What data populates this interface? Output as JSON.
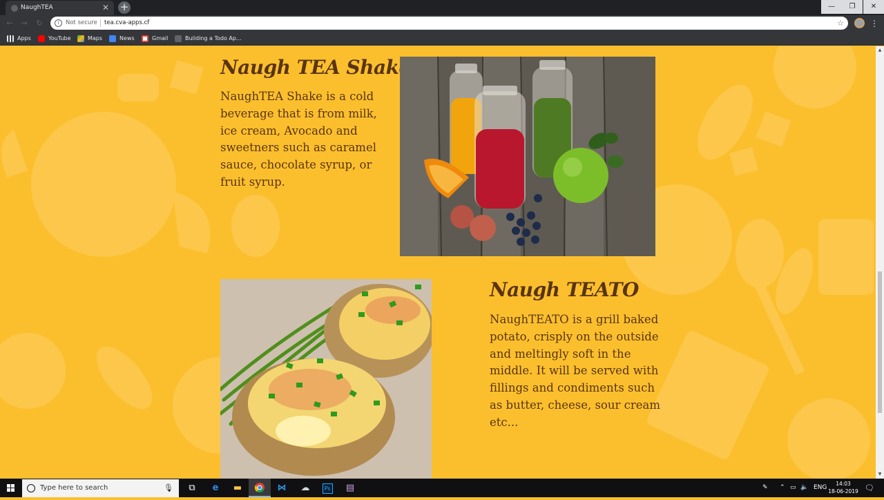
{
  "browser": {
    "tab_title": "NaughTEA",
    "tab_close": "✕",
    "new_tab": "+",
    "security_label": "Not secure",
    "url": "tea.cva-apps.cf",
    "window_min": "—",
    "window_max": "❐",
    "window_close": "✕"
  },
  "bookmarks": [
    {
      "label": "Apps",
      "color": "#e8eaed"
    },
    {
      "label": "YouTube",
      "color": "#ff0000"
    },
    {
      "label": "Maps",
      "color": "#34a853"
    },
    {
      "label": "News",
      "color": "#4285f4"
    },
    {
      "label": "Gmail",
      "color": "#ea4335"
    },
    {
      "label": "Building a Todo Ap...",
      "color": "#9aa0a6"
    }
  ],
  "content": {
    "shake": {
      "title": "Naugh TEA Shake",
      "description": "NaughTEA Shake is a cold beverage that is from milk, ice cream, Avocado and sweetners such as caramel sauce, chocolate syrup, or fruit syrup."
    },
    "teato": {
      "title": "Naugh TEATO",
      "description": "NaughTEATO is a grill baked potato, crisply on the outside and meltingly soft in the middle. It will be served with fillings and condiments such as butter, cheese, sour cream etc..."
    }
  },
  "colors": {
    "page_bg": "#fbbf2e",
    "heading": "#5a3410",
    "text": "#5a3410"
  },
  "taskbar": {
    "search_placeholder": "Type here to search",
    "language": "ENG",
    "time": "14:03",
    "date": "18-06-2019",
    "apps": [
      "task-view-icon",
      "edge-icon",
      "file-explorer-icon",
      "chrome-icon",
      "vscode-icon",
      "app-icon",
      "photoshop-icon",
      "media-icon"
    ]
  }
}
